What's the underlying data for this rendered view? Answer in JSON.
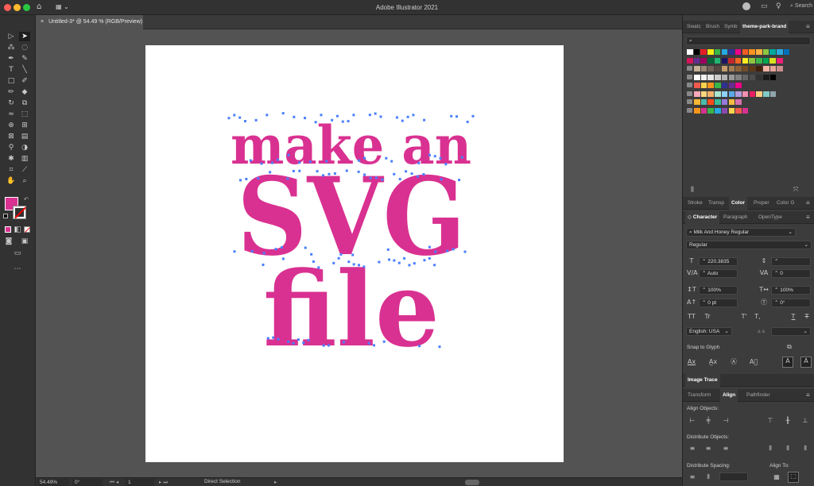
{
  "app_title": "Adobe Illustrator 2021",
  "document_tab": "Untitled-3* @ 54.49 % (RGB/Preview)",
  "tab_close": "×",
  "search_placeholder": "Search",
  "canvas_text": {
    "line1": "make an",
    "line2": "SVG",
    "line3": "file"
  },
  "colors": {
    "fill": "#d93191",
    "anchor": "#4a7fff",
    "accent": "#d93191"
  },
  "swatch_panel": {
    "tabs": [
      "Swatc",
      "Brush",
      "Symb",
      "theme-park-brand"
    ],
    "active_tab": "theme-park-brand",
    "rows": [
      [
        "#ffffff",
        "#000000",
        "#e31f26",
        "#f7ec13",
        "#3ab54a",
        "#25a9e1",
        "#2e3192",
        "#ec008c",
        "#f15a24",
        "#f7931e",
        "#fbb040",
        "#8cc63f",
        "#00a99d",
        "#29abe2",
        "#0071bc"
      ],
      [
        "#d4145a",
        "#662d91",
        "#9e005d",
        "#006837",
        "#22b573",
        "#1b1464",
        "#c1272d",
        "#f26522",
        "#fcee21",
        "#8dc63f",
        "#39b54a",
        "#00a651",
        "#d9e021",
        "#ed1e79"
      ],
      [
        "#c7b299",
        "#998675",
        "#736357",
        "#534741",
        "#c69c6d",
        "#a67c52",
        "#8c6239",
        "#754c24",
        "#603813",
        "#42210b",
        "#f2b3a4",
        "#e6a596",
        "#cc8d8d"
      ],
      [
        "#ffffff",
        "#f2f2f2",
        "#e6e6e6",
        "#cccccc",
        "#b3b3b3",
        "#999999",
        "#808080",
        "#666666",
        "#4d4d4d",
        "#333333",
        "#1a1a1a",
        "#000000"
      ],
      [
        "#f05a4e",
        "#fcd34e",
        "#f7941d",
        "#39b54a",
        "#2e3192",
        "#662d91",
        "#ec008c"
      ],
      [
        "#f7a8b8",
        "#f9d77e",
        "#f6b26b",
        "#a8e6cf",
        "#8ed1fc",
        "#5aa9e6",
        "#b39ddb",
        "#f48fb1",
        "#e91e63",
        "#ffcc80",
        "#80cbc4",
        "#90a4ae"
      ],
      [
        "#f7b733",
        "#4abdac",
        "#fc4a1a",
        "#37bc9b",
        "#967adc",
        "#f6bb42",
        "#d770ad"
      ],
      [
        "#f7941d",
        "#d93191",
        "#3ab54a",
        "#25a9e1",
        "#8a4baf",
        "#fcd34e",
        "#f05a4e",
        "#d93191"
      ]
    ]
  },
  "color_panel_tabs": [
    "Stroke",
    "Transp",
    "Color",
    "Proper",
    "Color G"
  ],
  "character_panel": {
    "tabs": [
      "Character",
      "Paragraph",
      "OpenType"
    ],
    "font_family": "Milk And Honey Regular",
    "font_style": "Regular",
    "font_size": "220.3835",
    "leading": "",
    "kerning": "Auto",
    "tracking": "0",
    "vertical_scale": "100%",
    "horizontal_scale": "100%",
    "baseline_shift": "0 pt",
    "rotation": "0°",
    "caps_row": [
      "TT",
      "Tr",
      "T'",
      "T,",
      "T",
      "T"
    ],
    "language": "English: USA",
    "aa_label": "a a",
    "snap_to_glyph": "Snap to Glyph"
  },
  "image_trace_label": "Image Trace",
  "align_panel": {
    "tabs": [
      "Transform",
      "Align",
      "Pathfinder"
    ],
    "align_objects": "Align Objects:",
    "distribute_objects": "Distribute Objects:",
    "distribute_spacing": "Distribute Spacing:",
    "align_to": "Align To:"
  },
  "status": {
    "zoom": "54.49%",
    "rotation": "0°",
    "artboard": "1",
    "tool": "Direct Selection"
  }
}
